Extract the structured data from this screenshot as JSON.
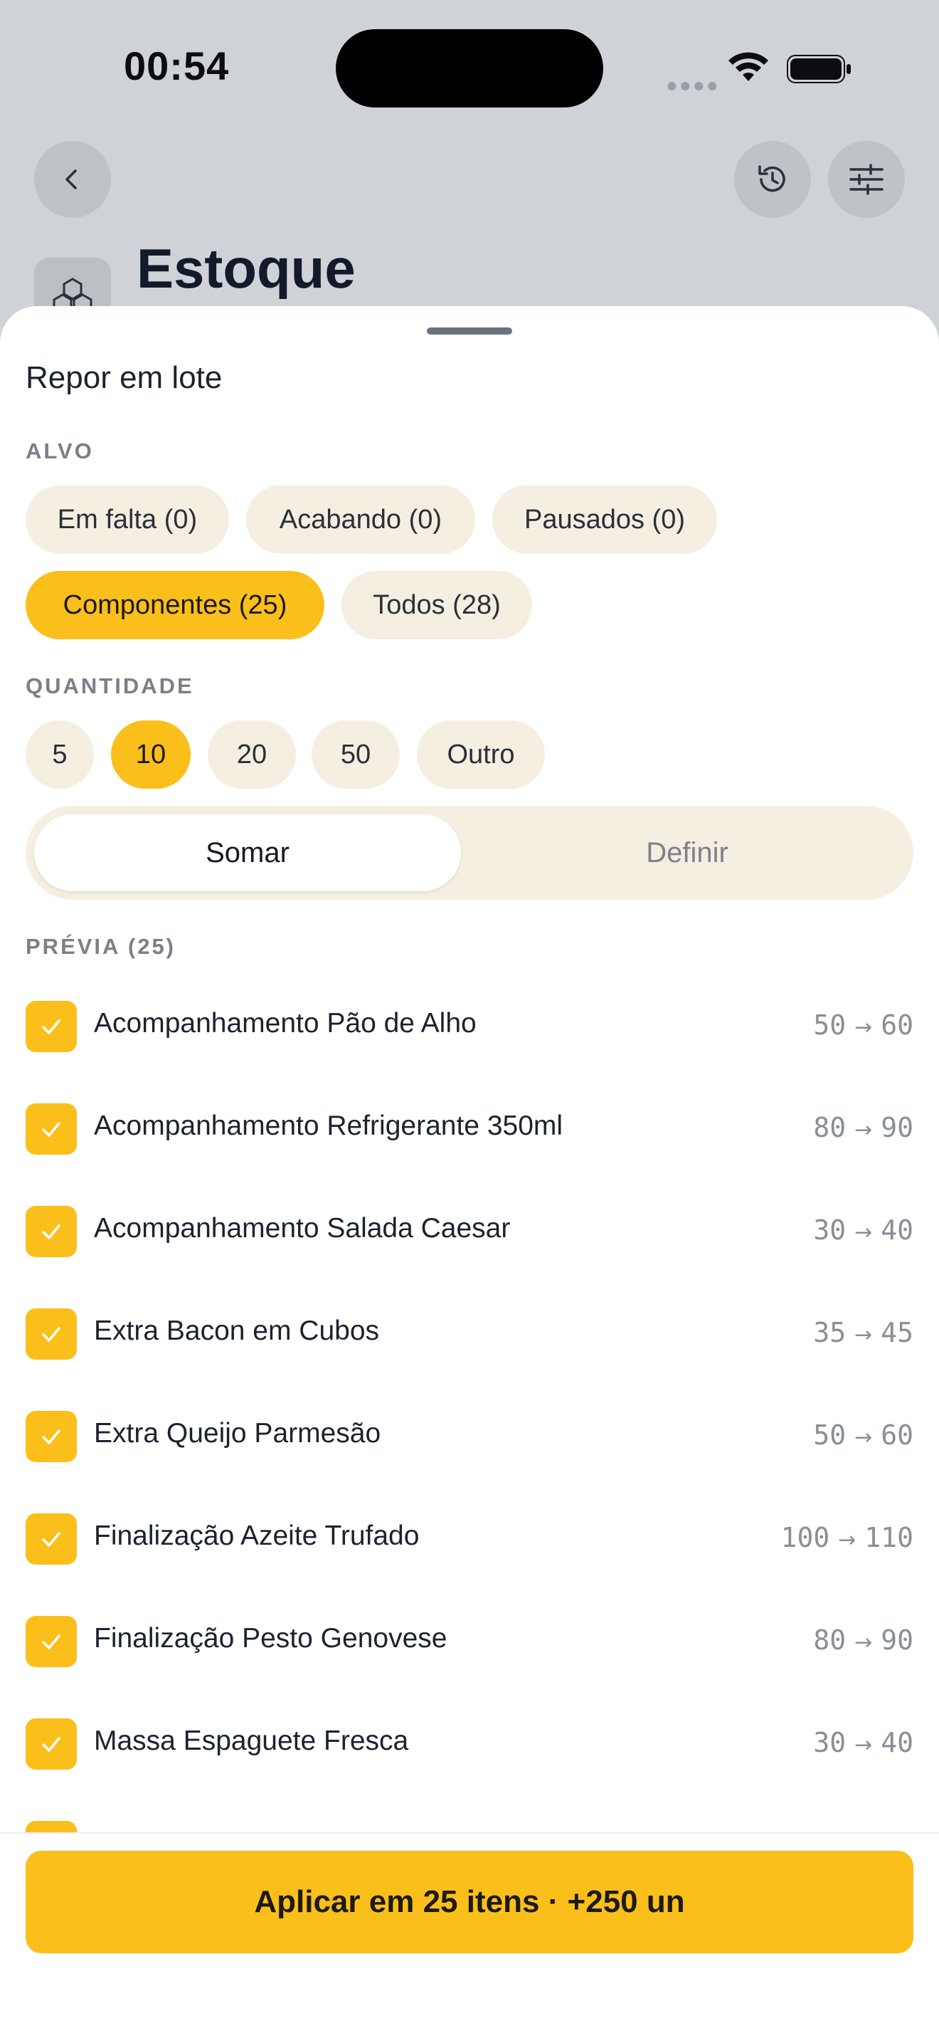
{
  "status": {
    "time": "00:54"
  },
  "header": {
    "title": "Estoque"
  },
  "sheet": {
    "title": "Repor em lote",
    "target_label": "ALVO",
    "target_chips": [
      {
        "label": "Em falta (0)"
      },
      {
        "label": "Acabando (0)"
      },
      {
        "label": "Pausados (0)"
      },
      {
        "label": "Componentes (25)",
        "selected": true
      },
      {
        "label": "Todos (28)"
      }
    ],
    "quantity_label": "QUANTIDADE",
    "quantity_chips": [
      {
        "label": "5"
      },
      {
        "label": "10",
        "selected": true
      },
      {
        "label": "20"
      },
      {
        "label": "50"
      },
      {
        "label": "Outro"
      }
    ],
    "mode": {
      "add": "Somar",
      "set": "Definir",
      "selected": "Somar"
    },
    "preview_label": "PRÉVIA (25)",
    "items": [
      {
        "name": "Acompanhamento Pão de Alho",
        "from": "50",
        "to": "60"
      },
      {
        "name": "Acompanhamento Refrigerante 350ml",
        "from": "80",
        "to": "90"
      },
      {
        "name": "Acompanhamento Salada Caesar",
        "from": "30",
        "to": "40"
      },
      {
        "name": "Extra Bacon em Cubos",
        "from": "35",
        "to": "45"
      },
      {
        "name": "Extra Queijo Parmesão",
        "from": "50",
        "to": "60"
      },
      {
        "name": "Finalização Azeite Trufado",
        "from": "100",
        "to": "110"
      },
      {
        "name": "Finalização Pesto Genovese",
        "from": "80",
        "to": "90"
      },
      {
        "name": "Massa Espaguete Fresca",
        "from": "30",
        "to": "40"
      }
    ],
    "apply_label": "Aplicar em 25 itens · +250 un"
  },
  "colors": {
    "accent": "#fbbf1b",
    "chip": "#f4efe1",
    "scrim": "#cfd2d6"
  },
  "icons": [
    "back-icon",
    "history-icon",
    "filter-icon",
    "box-icon",
    "check-icon",
    "wifi-icon",
    "battery-icon"
  ]
}
